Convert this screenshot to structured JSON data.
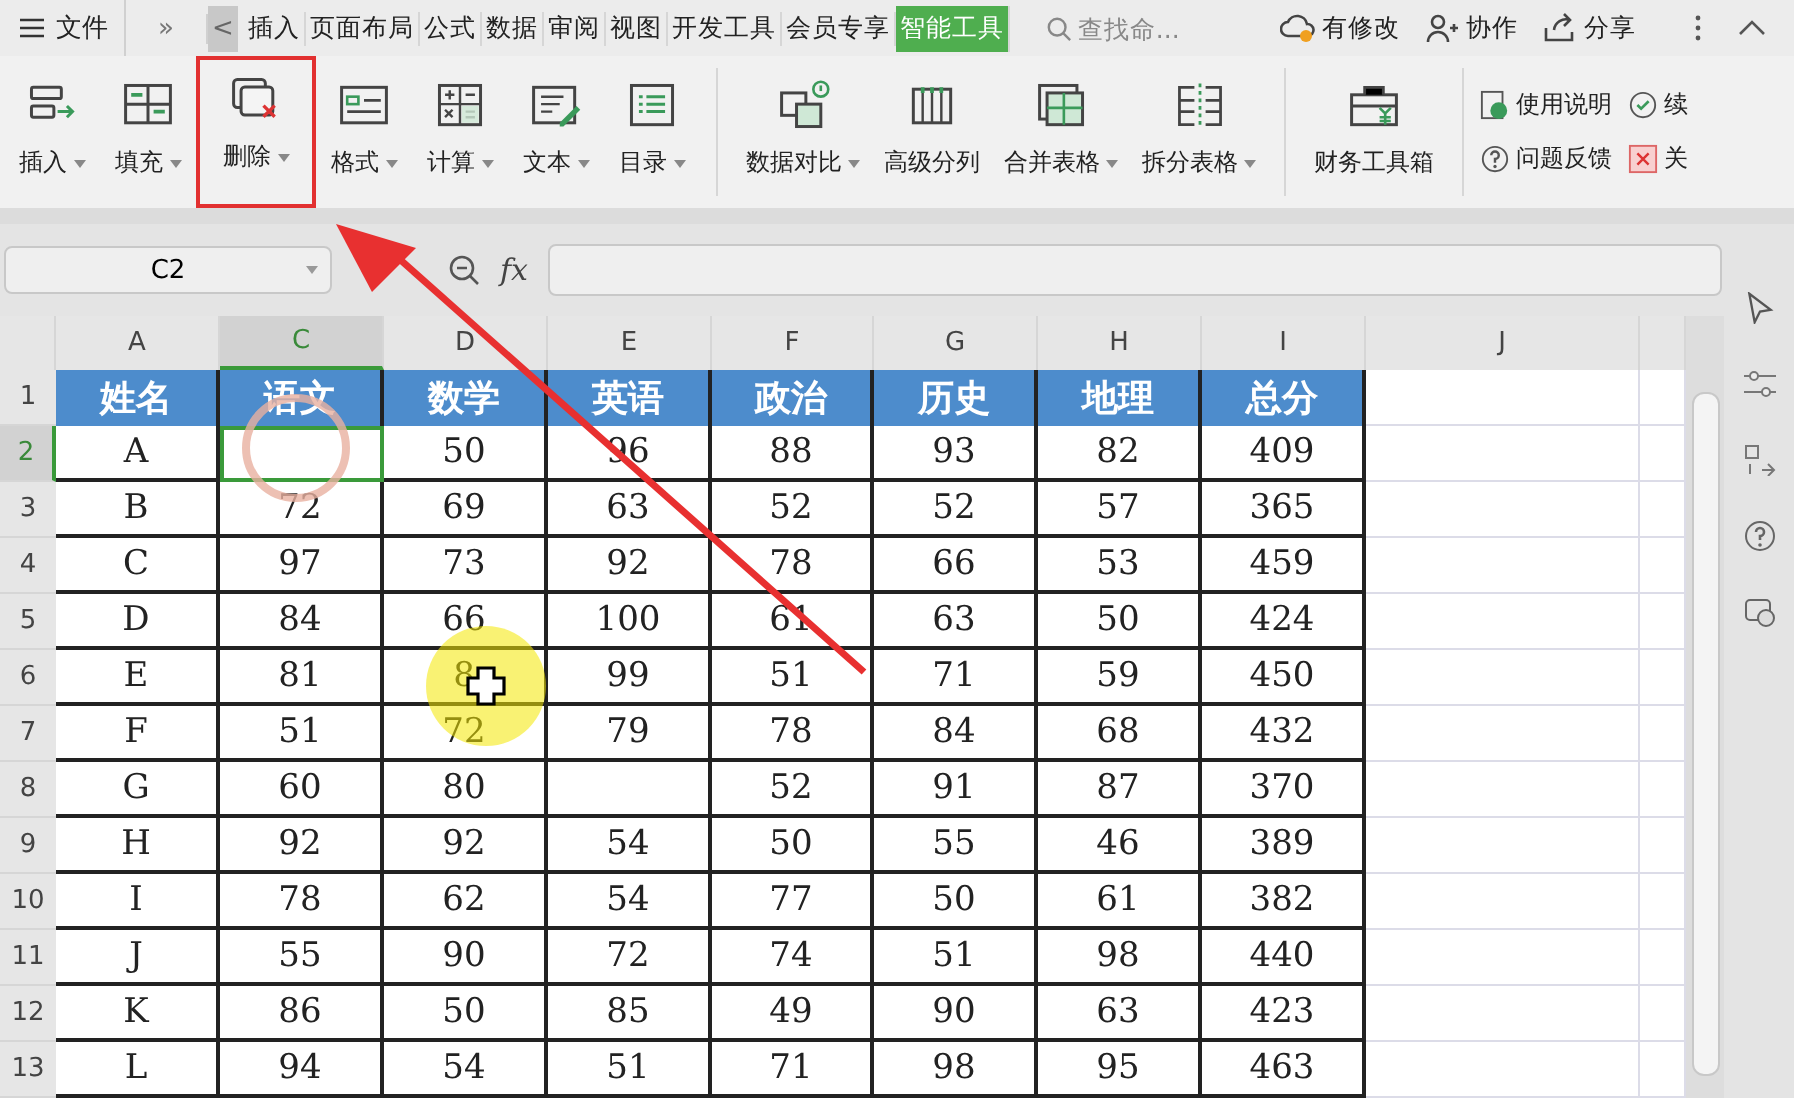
{
  "menu_bar": {
    "file_label": "文件",
    "more": "»",
    "scroll_left": "<",
    "tabs": [
      {
        "label": "插入",
        "selected": false
      },
      {
        "label": "页面布局",
        "selected": false
      },
      {
        "label": "公式",
        "selected": false
      },
      {
        "label": "数据",
        "selected": false
      },
      {
        "label": "审阅",
        "selected": false
      },
      {
        "label": "视图",
        "selected": false
      },
      {
        "label": "开发工具",
        "selected": false
      },
      {
        "label": "会员专享",
        "selected": false
      },
      {
        "label": "智能工具",
        "selected": true
      }
    ],
    "search": {
      "placeholder": "查找命..."
    },
    "actions": [
      "有修改",
      "协作",
      "分享"
    ]
  },
  "ribbon": {
    "groups": [
      {
        "buttons": [
          {
            "label": "插入",
            "dropdown": true,
            "highlighted": false
          },
          {
            "label": "填充",
            "dropdown": true,
            "highlighted": false
          },
          {
            "label": "删除",
            "dropdown": true,
            "highlighted": true
          },
          {
            "label": "格式",
            "dropdown": true,
            "highlighted": false
          },
          {
            "label": "计算",
            "dropdown": true,
            "highlighted": false
          },
          {
            "label": "文本",
            "dropdown": true,
            "highlighted": false
          },
          {
            "label": "目录",
            "dropdown": true,
            "highlighted": false
          }
        ]
      },
      {
        "buttons": [
          {
            "label": "数据对比",
            "dropdown": true,
            "highlighted": false
          },
          {
            "label": "高级分列",
            "dropdown": false,
            "highlighted": false
          },
          {
            "label": "合并表格",
            "dropdown": true,
            "highlighted": false
          },
          {
            "label": "拆分表格",
            "dropdown": true,
            "highlighted": false
          }
        ]
      },
      {
        "buttons": [
          {
            "label": "财务工具箱",
            "dropdown": false,
            "highlighted": false
          }
        ]
      }
    ],
    "small_buttons": [
      "使用说明",
      "续",
      "问题反馈",
      "关"
    ]
  },
  "formula_bar": {
    "name_box": "C2",
    "fx": "fx"
  },
  "sheet": {
    "columns": [
      {
        "label": "A",
        "selected": false
      },
      {
        "label": "C",
        "selected": true
      },
      {
        "label": "D",
        "selected": false
      },
      {
        "label": "E",
        "selected": false
      },
      {
        "label": "F",
        "selected": false
      },
      {
        "label": "G",
        "selected": false
      },
      {
        "label": "H",
        "selected": false
      },
      {
        "label": "I",
        "selected": false
      },
      {
        "label": "J",
        "selected": false
      }
    ],
    "header_row": {
      "number": "1",
      "cells": [
        "姓名",
        "语文",
        "数学",
        "英语",
        "政治",
        "历史",
        "地理",
        "总分"
      ]
    },
    "rows": [
      {
        "number": "2",
        "selected": true,
        "cells": [
          "A",
          null,
          "50",
          "96",
          "88",
          "93",
          "82",
          "409"
        ]
      },
      {
        "number": "3",
        "selected": false,
        "cells": [
          "B",
          "72",
          "69",
          "63",
          "52",
          "52",
          "57",
          "365"
        ]
      },
      {
        "number": "4",
        "selected": false,
        "cells": [
          "C",
          "97",
          "73",
          "92",
          "78",
          "66",
          "53",
          "459"
        ]
      },
      {
        "number": "5",
        "selected": false,
        "cells": [
          "D",
          "84",
          "66",
          "100",
          "61",
          "63",
          "50",
          "424"
        ]
      },
      {
        "number": "6",
        "selected": false,
        "cells": [
          "E",
          "81",
          "8",
          "99",
          "51",
          "71",
          "59",
          "450"
        ]
      },
      {
        "number": "7",
        "selected": false,
        "cells": [
          "F",
          "51",
          "72",
          "79",
          "78",
          "84",
          "68",
          "432"
        ]
      },
      {
        "number": "8",
        "selected": false,
        "cells": [
          "G",
          "60",
          "80",
          null,
          "52",
          "91",
          "87",
          "370"
        ]
      },
      {
        "number": "9",
        "selected": false,
        "cells": [
          "H",
          "92",
          "92",
          "54",
          "50",
          "55",
          "46",
          "389"
        ]
      },
      {
        "number": "10",
        "selected": false,
        "cells": [
          "I",
          "78",
          "62",
          "54",
          "77",
          "50",
          "61",
          "382"
        ]
      },
      {
        "number": "11",
        "selected": false,
        "cells": [
          "J",
          "55",
          "90",
          "72",
          "74",
          "51",
          "98",
          "440"
        ]
      },
      {
        "number": "12",
        "selected": false,
        "cells": [
          "K",
          "86",
          "50",
          "85",
          "49",
          "90",
          "63",
          "423"
        ]
      },
      {
        "number": "13",
        "selected": false,
        "cells": [
          "L",
          "94",
          "54",
          "51",
          "71",
          "98",
          "95",
          "463"
        ]
      }
    ]
  }
}
